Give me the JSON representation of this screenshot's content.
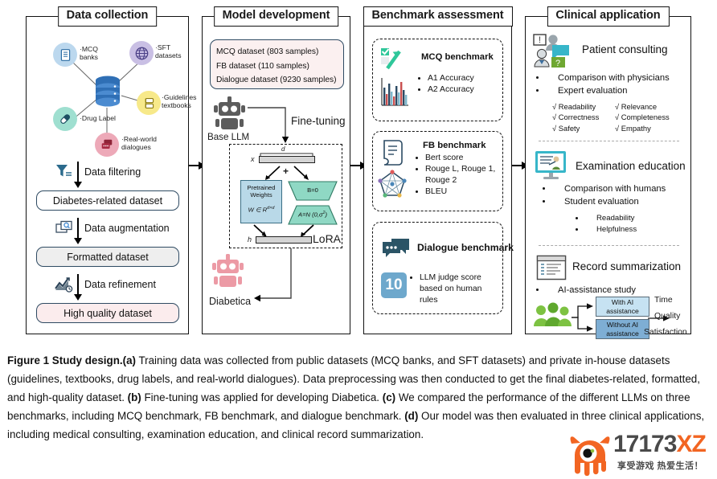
{
  "columns": {
    "c1": {
      "header": "Data collection"
    },
    "c2": {
      "header": "Model development"
    },
    "c3": {
      "header": "Benchmark assessment"
    },
    "c4": {
      "header": "Clinical application"
    }
  },
  "data_collection": {
    "sources": [
      {
        "label": "·MCQ\nbanks",
        "icon": "document-list-icon",
        "color": "#bcd8ee"
      },
      {
        "label": "·SFT\ndatasets",
        "icon": "globe-icon",
        "color": "#c9bfe4"
      },
      {
        "label": "·Guidelines\ntextbooks",
        "icon": "books-icon",
        "color": "#f7e98a"
      },
      {
        "label": "·Real-world\ndialogues",
        "icon": "chat-bubbles-icon",
        "color": "#eda9b8"
      },
      {
        "label": "·Drug Label",
        "icon": "pill-icon",
        "color": "#9fdfd0"
      }
    ],
    "database_icon": "database-icon",
    "steps": [
      {
        "label": "Data filtering",
        "icon": "filter-icon"
      },
      {
        "label": "Data augmentation",
        "icon": "augment-icon"
      },
      {
        "label": "Data refinement",
        "icon": "chart-refine-icon"
      }
    ],
    "datasets": [
      {
        "label": "Diabetes-related dataset",
        "fill": "#ffffff"
      },
      {
        "label": "Formatted dataset",
        "fill": "#eeeeee"
      },
      {
        "label": "High quality dataset",
        "fill": "#fbeced"
      }
    ]
  },
  "model_development": {
    "samples": [
      "MCQ dataset (803 samples)",
      "FB dataset (110 samples)",
      "Dialogue dataset (9230 samples)"
    ],
    "base_llm_label": "Base LLM",
    "base_llm_icon": "robot-icon",
    "finetuning_label": "Fine-tuning",
    "output_label": "Diabetica",
    "output_icon": "robot-pink-icon",
    "lora": {
      "d_label": "d",
      "x_label": "x",
      "h_label": "h",
      "plus_label": "+",
      "pretrained_line1": "Pretrained",
      "pretrained_line2": "Weights",
      "pretrained_formula": "W ∈ R",
      "pretrained_exp": "d×d",
      "b_label": "B=0",
      "a_label": "A=N (0,σ",
      "a_exp": "2",
      "a_tail": ")",
      "title": "LoRA",
      "pretrained_fill": "#b9d9e8",
      "adapter_fill": "#8fd8c4"
    }
  },
  "benchmarks": [
    {
      "title": "MCQ benchmark",
      "icons": [
        "check-arrow-icon",
        "bar-chart-icon"
      ],
      "items": [
        "A1 Accuracy",
        "A2 Accuracy"
      ]
    },
    {
      "title": "FB benchmark",
      "icons": [
        "document-scroll-icon",
        "radar-network-icon"
      ],
      "items": [
        "Bert score",
        "Rouge L, Rouge 1, Rouge 2",
        "BLEU"
      ]
    },
    {
      "title": "Dialogue benchmark",
      "icons": [
        "speech-bubbles-icon",
        "score-ten-icon"
      ],
      "items": [
        "LLM judge score based on human rules"
      ],
      "score_badge": "10"
    }
  ],
  "clinical": {
    "patient_consulting": {
      "title": "Patient consulting",
      "icon": "consulting-people-icon",
      "bullets": [
        "Comparison with physicians",
        "Expert evaluation"
      ],
      "checks": [
        [
          "Readability",
          "Relevance"
        ],
        [
          "Correctness",
          "Completeness"
        ],
        [
          "Safety",
          "Empathy"
        ]
      ],
      "check_mark": "√"
    },
    "examination_education": {
      "title": "Examination education",
      "icon": "teacher-screen-icon",
      "bullets": [
        "Comparison with humans",
        "Student evaluation"
      ],
      "subbullets": [
        "Readability",
        "Helpfulness"
      ]
    },
    "record_summarization": {
      "title": "Record summarization",
      "icon": "record-window-icon",
      "bullet": "AI-assistance study",
      "people_icon": "people-group-icon",
      "arms": [
        {
          "line1": "With AI",
          "line2": "assistance",
          "fill": "#c6e2f2"
        },
        {
          "line1": "Without AI",
          "line2": "assistance",
          "fill": "#7eaed4"
        }
      ],
      "outcomes": [
        "Time",
        "Quality",
        "Satisfaction"
      ]
    }
  },
  "caption": {
    "fig_label": "Figure 1 Study design.",
    "a_tag": "(a)",
    "a_text": " Training data was collected from public datasets (MCQ banks, and SFT datasets) and private in-house datasets (guidelines, textbooks, drug labels, and real-world dialogues). Data preprocessing was then conducted to get the final diabetes-related, formatted, and high-quality dataset. ",
    "b_tag": "(b)",
    "b_text": " Fine-tuning was applied for developing Diabetica. ",
    "c_tag": "(c)",
    "c_text": " We compared the performance of the different LLMs on three benchmarks, including MCQ benchmark, FB benchmark, and dialogue benchmark. ",
    "d_tag": "(d)",
    "d_text": " Our model was then evaluated in three clinical applications, including medical consulting, examination education, and clinical record summarization."
  },
  "watermark": {
    "brand_main": "17173",
    "brand_accent": "XZ",
    "slogan": "享受游戏 热爱生活！",
    "mascot_icon": "monster-mascot-icon",
    "accent_color": "#f26522"
  }
}
